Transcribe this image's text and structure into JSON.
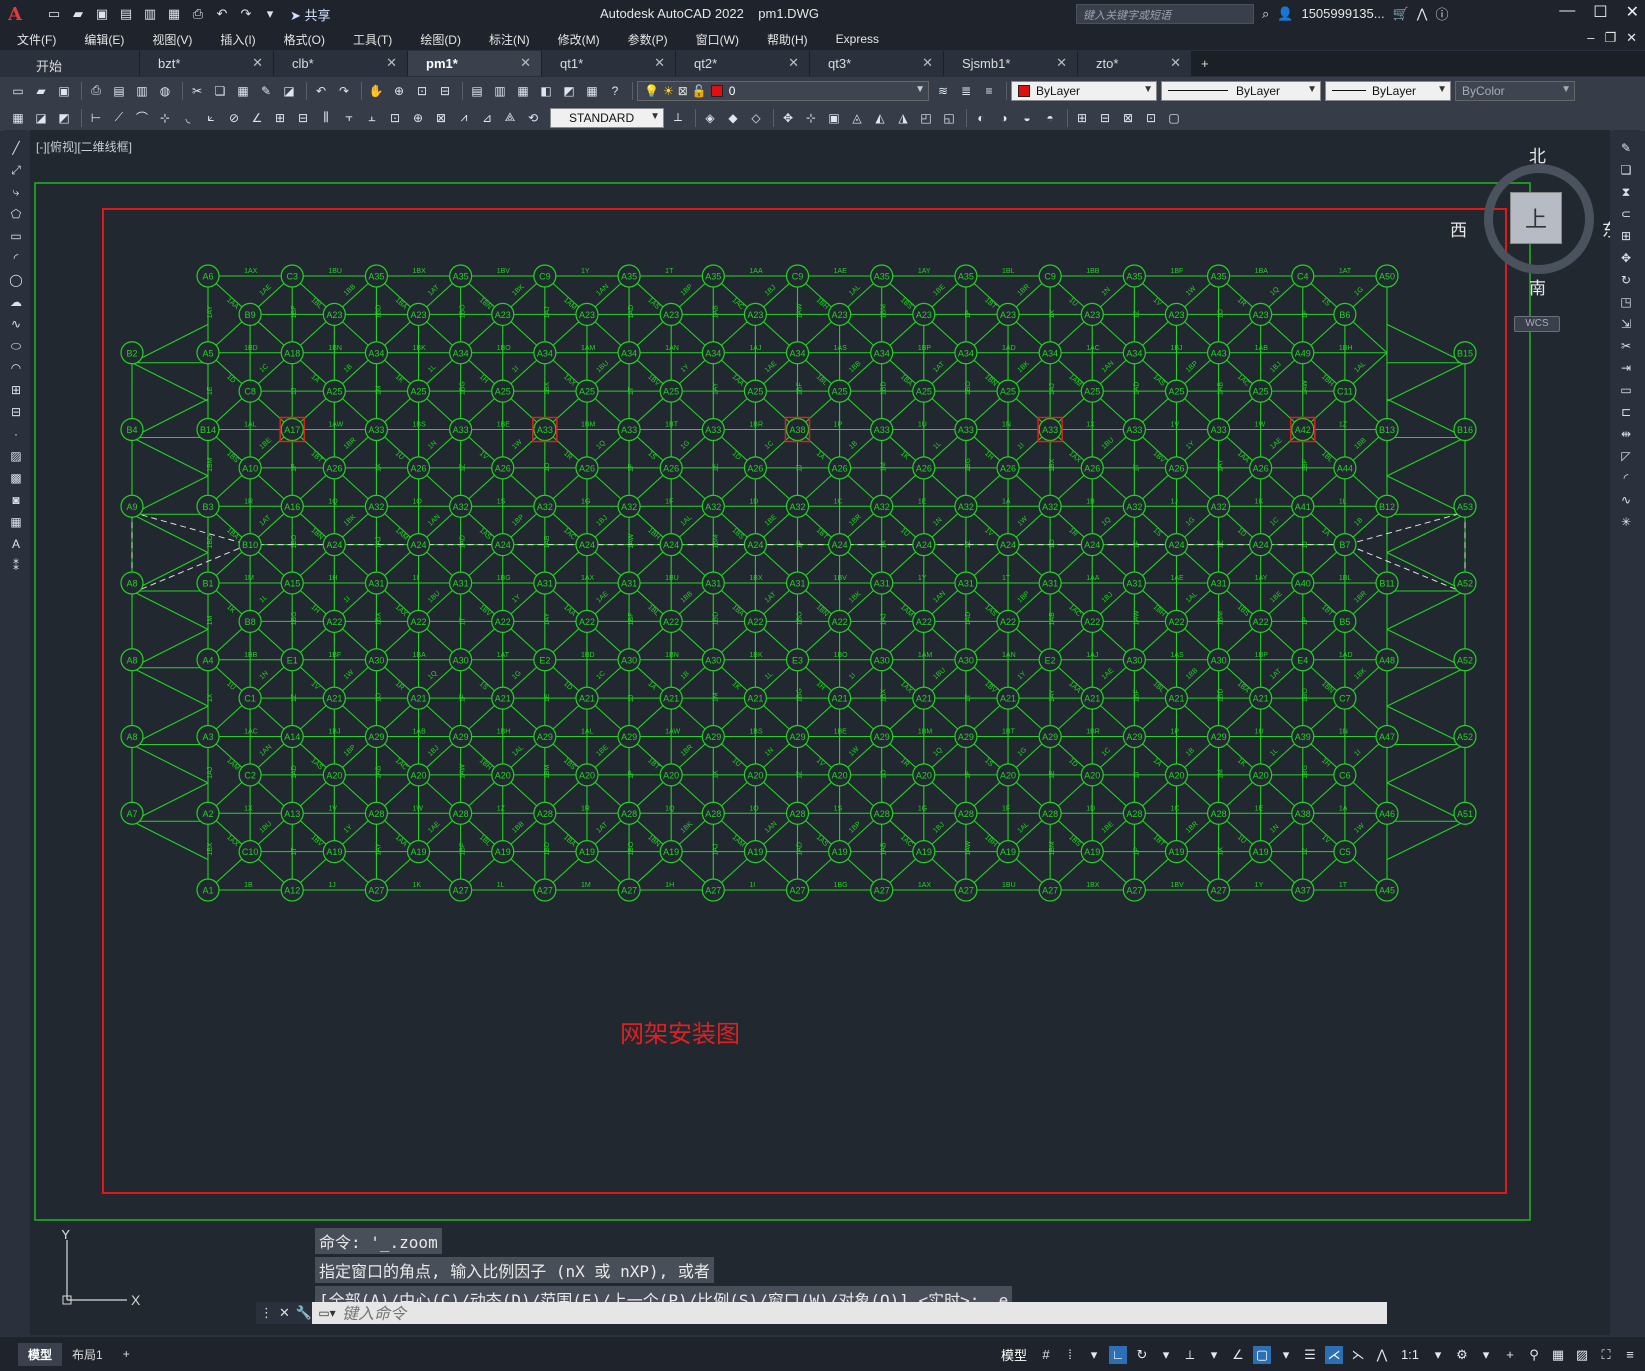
{
  "titlebar": {
    "logo": "A",
    "share": "共享",
    "app_title": "Autodesk AutoCAD 2022",
    "document": "pm1.DWG",
    "search_placeholder": "键入关键字或短语",
    "user": "1505999135..."
  },
  "menu": [
    "文件(F)",
    "编辑(E)",
    "视图(V)",
    "插入(I)",
    "格式(O)",
    "工具(T)",
    "绘图(D)",
    "标注(N)",
    "修改(M)",
    "参数(P)",
    "窗口(W)",
    "帮助(H)",
    "Express"
  ],
  "tabs": [
    {
      "label": "开始",
      "active": false,
      "closable": false
    },
    {
      "label": "bzt*",
      "active": false,
      "closable": true
    },
    {
      "label": "clb*",
      "active": false,
      "closable": true
    },
    {
      "label": "pm1*",
      "active": true,
      "closable": true
    },
    {
      "label": "qt1*",
      "active": false,
      "closable": true
    },
    {
      "label": "qt2*",
      "active": false,
      "closable": true
    },
    {
      "label": "qt3*",
      "active": false,
      "closable": true
    },
    {
      "label": "Sjsmb1*",
      "active": false,
      "closable": true
    },
    {
      "label": "zto*",
      "active": false,
      "closable": true
    }
  ],
  "toolbar": {
    "layer_value": "0",
    "color_value": "ByLayer",
    "linetype_value": "ByLayer",
    "lineweight_value": "ByLayer",
    "plotstyle_value": "ByColor",
    "textstyle_value": "STANDARD",
    "color_swatch": "#e01010"
  },
  "viewport": {
    "label": "[-][俯视][二维线框]",
    "viewcube": {
      "north": "北",
      "south": "南",
      "east": "东",
      "west": "西",
      "face": "上",
      "wcs": "WCS"
    },
    "drawing_title": "网架安装图",
    "colors": {
      "grid": "#22d422",
      "border_outer": "#1fb81f",
      "border_inner": "#e01818",
      "background": "#212830"
    },
    "node_rows": [
      [
        "A6",
        "C3",
        "A35",
        "A35",
        "C9",
        "A35",
        "A35",
        "C9",
        "A35",
        "A35",
        "C9",
        "A35",
        "A35",
        "C4",
        "A50"
      ],
      [
        "B9",
        "A23",
        "A23",
        "A23",
        "A23",
        "A23",
        "A23",
        "A23",
        "A23",
        "A23",
        "A23",
        "A23",
        "A23",
        "B6"
      ],
      [
        "B2",
        "A5",
        "A18",
        "A34",
        "A34",
        "A34",
        "A34",
        "A34",
        "A34",
        "A34",
        "A34",
        "A34",
        "A34",
        "A43",
        "A49",
        "B15"
      ],
      [
        "C8",
        "A25",
        "A25",
        "A25",
        "A25",
        "A25",
        "A25",
        "A25",
        "A25",
        "A25",
        "A25",
        "A25",
        "A25",
        "C11"
      ],
      [
        "B4",
        "B14",
        "A17",
        "A33",
        "A33",
        "A33",
        "A33",
        "A33",
        "A38",
        "A33",
        "A33",
        "A33",
        "A33",
        "A33",
        "A42",
        "B13",
        "B16"
      ],
      [
        "A10",
        "A26",
        "A26",
        "A26",
        "A26",
        "A26",
        "A26",
        "A26",
        "A26",
        "A26",
        "A26",
        "A26",
        "A26",
        "A44"
      ],
      [
        "A9",
        "B3",
        "A16",
        "A32",
        "A32",
        "A32",
        "A32",
        "A32",
        "A32",
        "A32",
        "A32",
        "A32",
        "A32",
        "A32",
        "A41",
        "B12",
        "A53"
      ],
      [
        "B10",
        "A24",
        "A24",
        "A24",
        "A24",
        "A24",
        "A24",
        "A24",
        "A24",
        "A24",
        "A24",
        "A24",
        "A24",
        "B7"
      ],
      [
        "A8",
        "B1",
        "A15",
        "A31",
        "A31",
        "A31",
        "A31",
        "A31",
        "A31",
        "A31",
        "A31",
        "A31",
        "A31",
        "A31",
        "A40",
        "B11",
        "A52"
      ],
      [
        "B8",
        "A22",
        "A22",
        "A22",
        "A22",
        "A22",
        "A22",
        "A22",
        "A22",
        "A22",
        "A22",
        "A22",
        "A22",
        "B5"
      ],
      [
        "A8",
        "A4",
        "E1",
        "A30",
        "A30",
        "E2",
        "A30",
        "A30",
        "E3",
        "A30",
        "A30",
        "E2",
        "A30",
        "A30",
        "E4",
        "A48",
        "A52"
      ],
      [
        "C1",
        "A21",
        "A21",
        "A21",
        "A21",
        "A21",
        "A21",
        "A21",
        "A21",
        "A21",
        "A21",
        "A21",
        "A21",
        "C7"
      ],
      [
        "A8",
        "A3",
        "A14",
        "A29",
        "A29",
        "A29",
        "A29",
        "A29",
        "A29",
        "A29",
        "A29",
        "A29",
        "A29",
        "A29",
        "A39",
        "A47",
        "A52"
      ],
      [
        "C2",
        "A20",
        "A20",
        "A20",
        "A20",
        "A20",
        "A20",
        "A20",
        "A20",
        "A20",
        "A20",
        "A20",
        "A20",
        "C6"
      ],
      [
        "A7",
        "A2",
        "A13",
        "A28",
        "A28",
        "A28",
        "A28",
        "A28",
        "A28",
        "A28",
        "A28",
        "A28",
        "A28",
        "A28",
        "A38",
        "A46",
        "A51"
      ],
      [
        "C10",
        "A19",
        "A19",
        "A19",
        "A19",
        "A19",
        "A19",
        "A19",
        "A19",
        "A19",
        "A19",
        "A19",
        "A19",
        "C5"
      ],
      [
        "A1",
        "A12",
        "A27",
        "A27",
        "A27",
        "A27",
        "A27",
        "A27",
        "A27",
        "A27",
        "A27",
        "A27",
        "A27",
        "A37",
        "A45"
      ]
    ],
    "member_labels": [
      "1AX",
      "1BU",
      "1BX",
      "1BV",
      "1Y",
      "1T",
      "1AA",
      "1AE",
      "1AY",
      "1BL",
      "1BB",
      "1BF",
      "1BA",
      "1AT",
      "1BD",
      "1BN",
      "1BK",
      "1BO",
      "1AM",
      "1AN",
      "1AJ",
      "1AS",
      "1BP",
      "1AD",
      "1AC",
      "1BJ",
      "1AB",
      "1BH",
      "1AL",
      "1AW",
      "1BS",
      "1BE",
      "1BM",
      "1BT",
      "1BR",
      "1P",
      "1U",
      "1N",
      "1X",
      "1V",
      "1W",
      "1Z",
      "1R",
      "1Q",
      "1O",
      "1S",
      "1G",
      "1F",
      "1D",
      "1C",
      "1E",
      "1A",
      "1B",
      "1J",
      "1K",
      "1L",
      "1M",
      "1H",
      "1I",
      "1BG"
    ],
    "highlighted_nodes": [
      "A17",
      "A33",
      "A38",
      "A33",
      "A42"
    ]
  },
  "command": {
    "history": [
      "命令: '_.zoom",
      "指定窗口的角点, 输入比例因子 (nX 或 nXP), 或者",
      "[全部(A)/中心(C)/动态(D)/范围(E)/上一个(P)/比例(S)/窗口(W)/对象(O)] <实时>: _e"
    ],
    "placeholder": "键入命令"
  },
  "status": {
    "layout_tabs": [
      "模型",
      "布局1"
    ],
    "model_label": "模型",
    "scale": "1:1"
  }
}
